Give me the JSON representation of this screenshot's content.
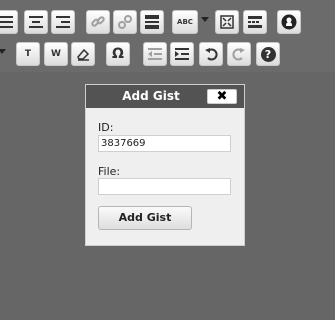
{
  "toolbar": {
    "row1": [
      {
        "icon": "align-justify-icon"
      },
      {
        "icon": "align-center-icon"
      },
      {
        "icon": "align-right-icon"
      },
      {
        "icon": "link-icon"
      },
      {
        "icon": "unlink-icon"
      },
      {
        "icon": "insert-more-icon"
      },
      {
        "icon": "spellcheck-icon",
        "glyph": "ABC"
      },
      {
        "icon": "fullscreen-icon"
      },
      {
        "icon": "kitchen-sink-icon"
      },
      {
        "icon": "github-icon"
      }
    ],
    "row2": [
      {
        "icon": "paste-text-icon",
        "glyph": "T"
      },
      {
        "icon": "paste-word-icon",
        "glyph": "W"
      },
      {
        "icon": "clear-formatting-icon"
      },
      {
        "icon": "special-character-icon",
        "glyph": "Ω"
      },
      {
        "icon": "outdent-icon"
      },
      {
        "icon": "indent-icon"
      },
      {
        "icon": "undo-icon"
      },
      {
        "icon": "redo-icon"
      },
      {
        "icon": "help-icon",
        "glyph": "?"
      }
    ]
  },
  "dialog": {
    "title": "Add Gist",
    "close_label": "✖",
    "id_label": "ID:",
    "id_value": "3837669",
    "file_label": "File:",
    "file_value": "",
    "submit_label": "Add Gist"
  }
}
